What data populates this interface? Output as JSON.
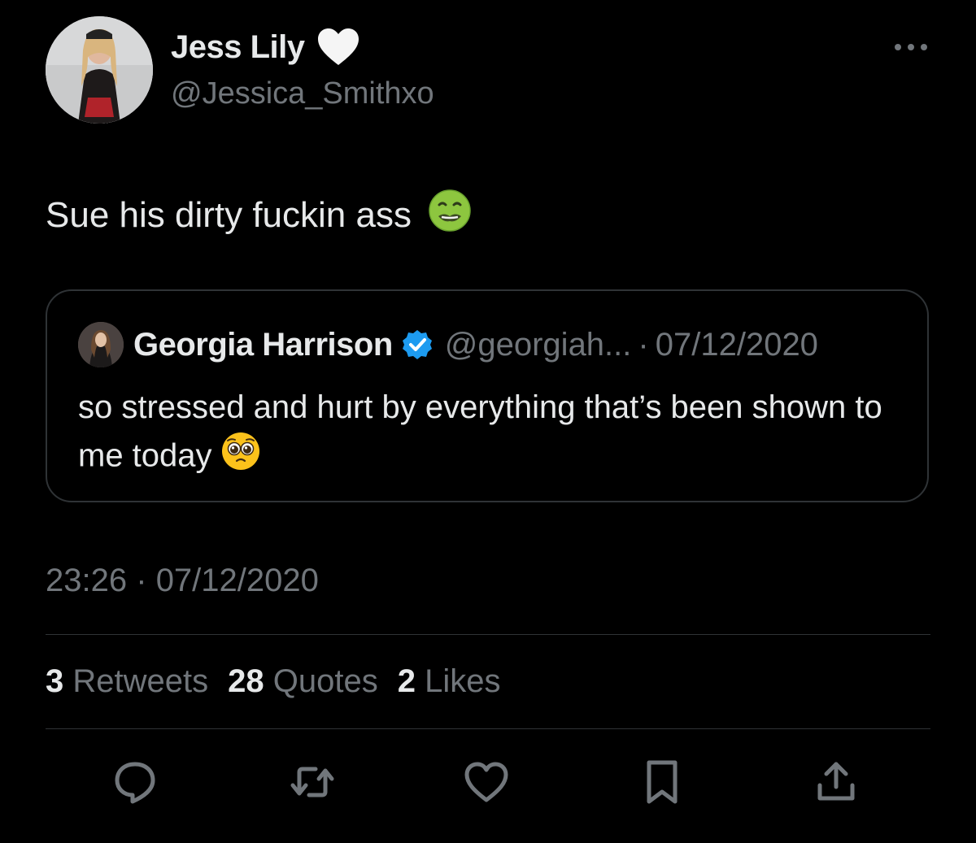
{
  "tweet": {
    "author": {
      "display_name": "Jess Lily",
      "handle": "@Jessica_Smithxo"
    },
    "text": "Sue his dirty fuckin ass",
    "text_emoji": "nauseated-face-emoji",
    "timestamp": {
      "time": "23:26",
      "separator": "·",
      "date": "07/12/2020"
    }
  },
  "quote": {
    "author": {
      "display_name": "Georgia Harrison",
      "handle": "@georgiah...",
      "separator": "·",
      "date": "07/12/2020",
      "verified": true
    },
    "text": "so stressed and hurt by everything that’s been shown to me today",
    "text_emoji": "pleading-face-emoji"
  },
  "stats": [
    {
      "count": "3",
      "label": "Retweets"
    },
    {
      "count": "28",
      "label": "Quotes"
    },
    {
      "count": "2",
      "label": "Likes"
    }
  ],
  "actions": [
    {
      "name": "reply-icon"
    },
    {
      "name": "retweet-icon"
    },
    {
      "name": "like-icon"
    },
    {
      "name": "bookmark-icon"
    },
    {
      "name": "share-icon"
    }
  ],
  "colors": {
    "background": "#000000",
    "primary_text": "#e7e9ea",
    "secondary_text": "#71767b",
    "border": "#2f3336",
    "verified_blue": "#1d9bf0"
  }
}
